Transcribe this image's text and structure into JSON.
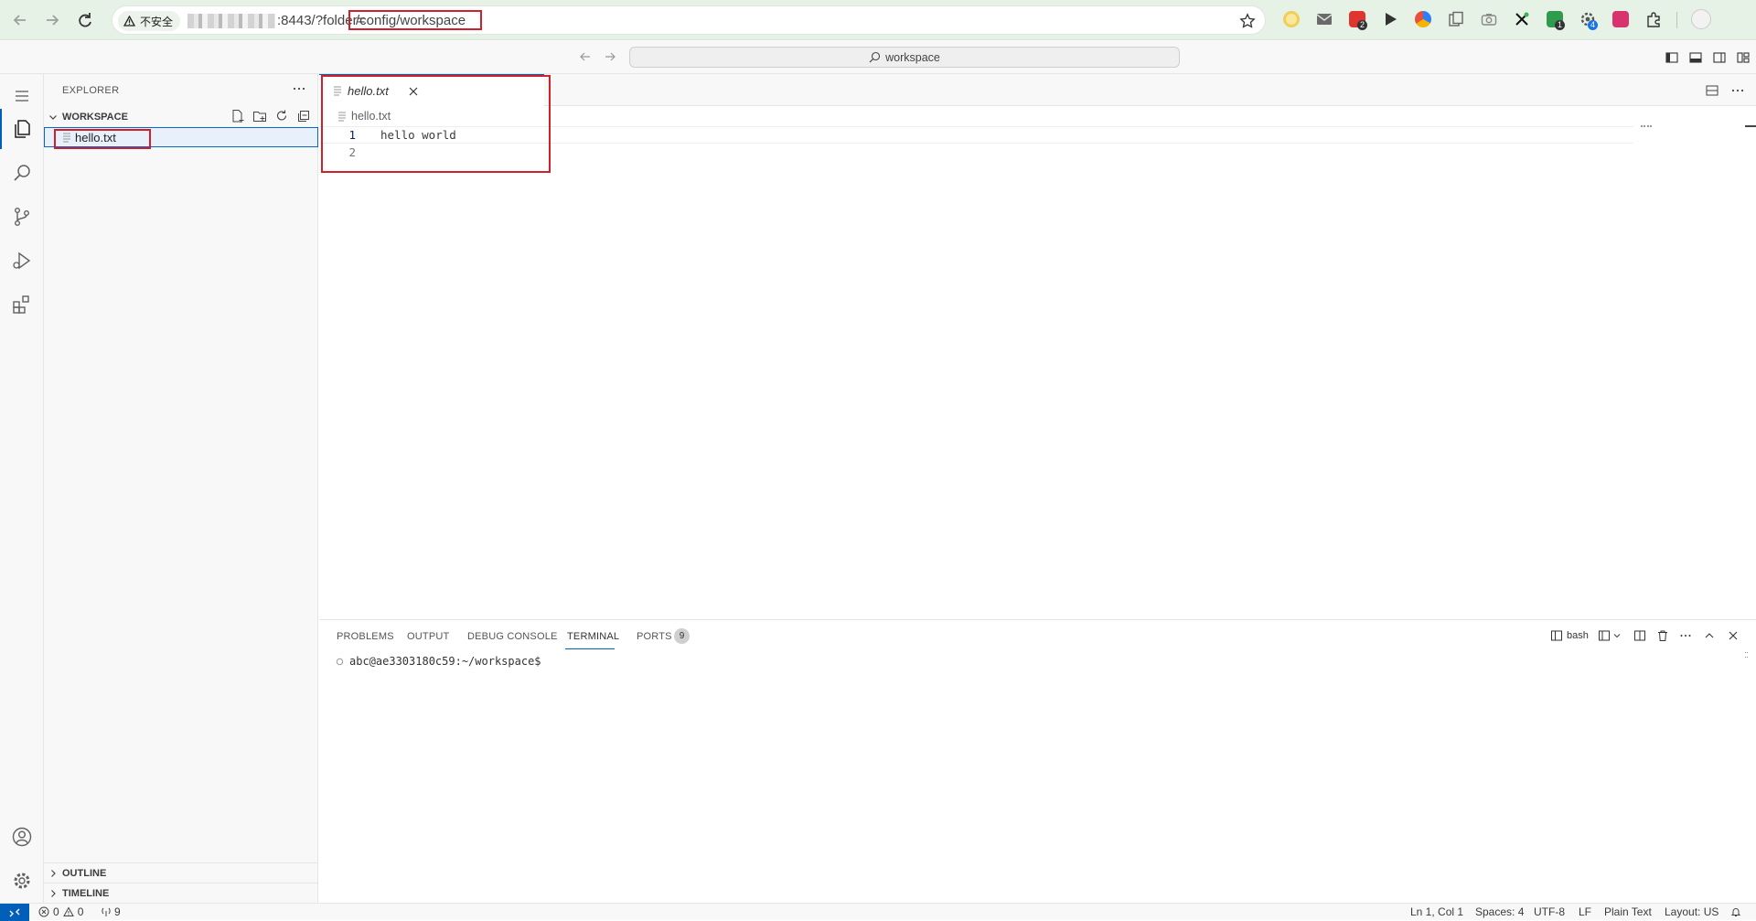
{
  "browser": {
    "security_label": "不安全",
    "url_visible": ":8443/?folder=",
    "url_path": "/config/workspace",
    "extension_badges": [
      "2",
      "1",
      "4"
    ]
  },
  "titlebar": {
    "search_text": "workspace"
  },
  "sidebar": {
    "title": "EXPLORER",
    "workspace_label": "WORKSPACE",
    "files": [
      {
        "name": "hello.txt"
      }
    ],
    "outline_label": "OUTLINE",
    "timeline_label": "TIMELINE"
  },
  "editor": {
    "tab_label": "hello.txt",
    "breadcrumb": "hello.txt",
    "lines": [
      {
        "number": "1",
        "text": "hello world"
      },
      {
        "number": "2",
        "text": ""
      }
    ]
  },
  "panel": {
    "tabs": [
      "PROBLEMS",
      "OUTPUT",
      "DEBUG CONSOLE",
      "TERMINAL",
      "PORTS"
    ],
    "active_tab": "TERMINAL",
    "ports_count": "9",
    "terminal_name": "bash",
    "prompt": "abc@ae3303180c59:~/workspace$"
  },
  "statusbar": {
    "errors": "0",
    "warnings": "0",
    "ports": "9",
    "cursor": "Ln 1, Col 1",
    "spaces": "Spaces: 4",
    "encoding": "UTF-8",
    "eol": "LF",
    "language": "Plain Text",
    "layout": "Layout: US"
  },
  "colors": {
    "accent": "#005fb8",
    "annotation_red": "#d0202b",
    "browser_chrome": "#e6f2e6"
  }
}
